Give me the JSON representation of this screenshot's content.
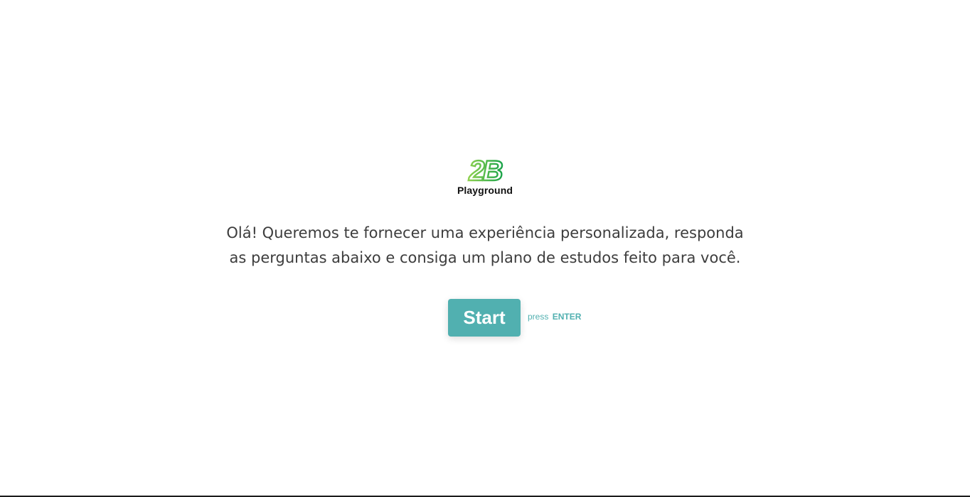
{
  "logo": {
    "mark_text": "2B",
    "name": "Playground",
    "colors": {
      "light": "#8fd14f",
      "dark": "#1aa34a"
    }
  },
  "welcome": {
    "line1": "Olá! Queremos te fornecer uma experiência personalizada, responda",
    "line2": "as perguntas abaixo e consiga um plano de estudos feito para você."
  },
  "start": {
    "label": "Start",
    "hint_prefix": "press",
    "hint_key": "ENTER"
  },
  "colors": {
    "accent": "#51b0b0",
    "text": "#3d3d3d"
  }
}
